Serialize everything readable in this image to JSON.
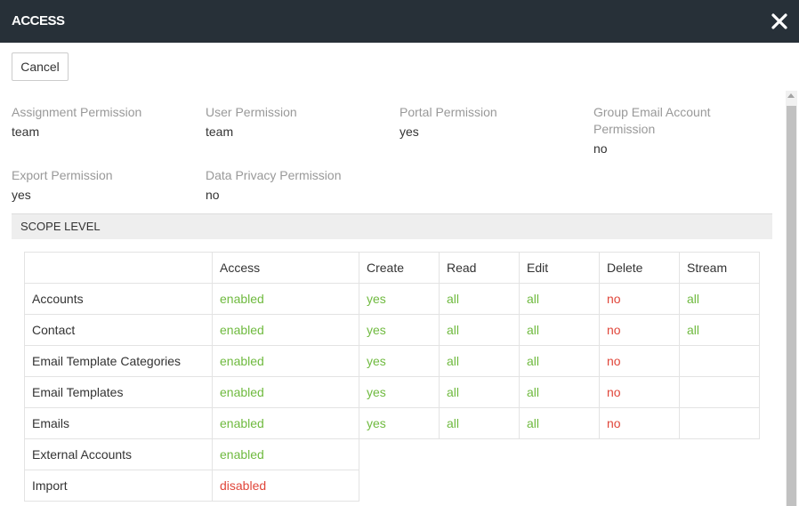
{
  "dialog": {
    "title": "ACCESS",
    "cancel_label": "Cancel"
  },
  "colors": {
    "header_bg": "#273038",
    "positive": "#6fba3f",
    "negative": "#e0463a",
    "label_gray": "#999999"
  },
  "permissions": [
    {
      "label": "Assignment Permission",
      "value": "team"
    },
    {
      "label": "User Permission",
      "value": "team"
    },
    {
      "label": "Portal Permission",
      "value": "yes"
    },
    {
      "label": "Group Email Account Permission",
      "value": "no"
    },
    {
      "label": "Export Permission",
      "value": "yes"
    },
    {
      "label": "Data Privacy Permission",
      "value": "no"
    }
  ],
  "scope": {
    "section_title": "SCOPE LEVEL",
    "columns": [
      "",
      "Access",
      "Create",
      "Read",
      "Edit",
      "Delete",
      "Stream"
    ],
    "rows": [
      {
        "name": "Accounts",
        "access": "enabled",
        "create": "yes",
        "read": "all",
        "edit": "all",
        "delete": "no",
        "stream": "all"
      },
      {
        "name": "Contact",
        "access": "enabled",
        "create": "yes",
        "read": "all",
        "edit": "all",
        "delete": "no",
        "stream": "all"
      },
      {
        "name": "Email Template Categories",
        "access": "enabled",
        "create": "yes",
        "read": "all",
        "edit": "all",
        "delete": "no",
        "stream": ""
      },
      {
        "name": "Email Templates",
        "access": "enabled",
        "create": "yes",
        "read": "all",
        "edit": "all",
        "delete": "no",
        "stream": ""
      },
      {
        "name": "Emails",
        "access": "enabled",
        "create": "yes",
        "read": "all",
        "edit": "all",
        "delete": "no",
        "stream": ""
      },
      {
        "name": "External Accounts",
        "access": "enabled"
      },
      {
        "name": "Import",
        "access": "disabled"
      }
    ]
  }
}
